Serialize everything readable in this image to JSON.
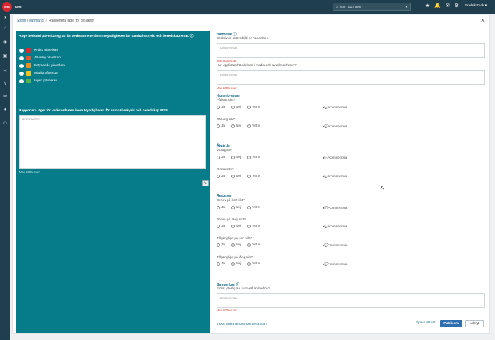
{
  "app": {
    "logo_text": "msb",
    "brand": "WIS"
  },
  "search": {
    "placeholder": "Sök i hela WIS"
  },
  "user": {
    "name": "Fredrik Rack"
  },
  "breadcrumb": {
    "parent": "Storm i Värmland",
    "current": "Rapportera läget för din aktör"
  },
  "left": {
    "heading": "Ange bedömd påverkansgrad för verksamheten inom Myndigheten för samhällsskydd och beredskap MSB.",
    "levels": [
      {
        "label": "Kritisk påverkan",
        "color": "#d9262f"
      },
      {
        "label": "Allvarlig påverkan",
        "color": "#e6552b"
      },
      {
        "label": "Betydande påverkan",
        "color": "#f08c1a"
      },
      {
        "label": "Måttlig påverkan",
        "color": "#f2c418"
      },
      {
        "label": "Ingen påverkan",
        "color": "#58b34a"
      }
    ],
    "report_heading": "Rapportera läget för verksamheten inom Myndigheten för samhällsskydd och beredskap MSB",
    "placeholder": "Kommentar",
    "max": "Max 500 tecken"
  },
  "right": {
    "handelse": {
      "title": "Händelse",
      "q1": "Beskriv er aktörs bild av händelsen",
      "q2": "Hur uppfattas händelsen i media och av allmänheten?",
      "placeholder": "Kommentar",
      "max": "Max 500 tecken"
    },
    "radio_labels": {
      "ja": "Ja",
      "nej": "Nej",
      "vet_ej": "Vet ej"
    },
    "comment_link": "Kommentera",
    "konsekvenser": {
      "title": "Konsekvenser",
      "q1": "På kort sikt?",
      "q2": "På lång sikt?"
    },
    "atgarder": {
      "title": "Åtgärder",
      "q1": "Vidtagna?",
      "q2": "Planerade?"
    },
    "resurser": {
      "title": "Resurser",
      "q1": "Behov på kort sikt?",
      "q2": "Behov på lång sikt?",
      "q3": "Tillgängliga på kort sikt?",
      "q4": "Tillgängliga på lång sikt?"
    },
    "samverkan": {
      "title": "Samverkan",
      "q1": "Finns ytterligare samverkansbehov?"
    },
    "tipsa": "Tipsa andra aktörer om detta yta",
    "buttons": {
      "spara_utkast": "Spara utkast",
      "publicera": "Publicera",
      "avbryt": "Avbryt"
    }
  },
  "colors": {
    "topbar": "#1f3e4e",
    "left_panel": "#067b8a",
    "accent": "#1c6f88",
    "primary_button": "#2f6fae"
  }
}
